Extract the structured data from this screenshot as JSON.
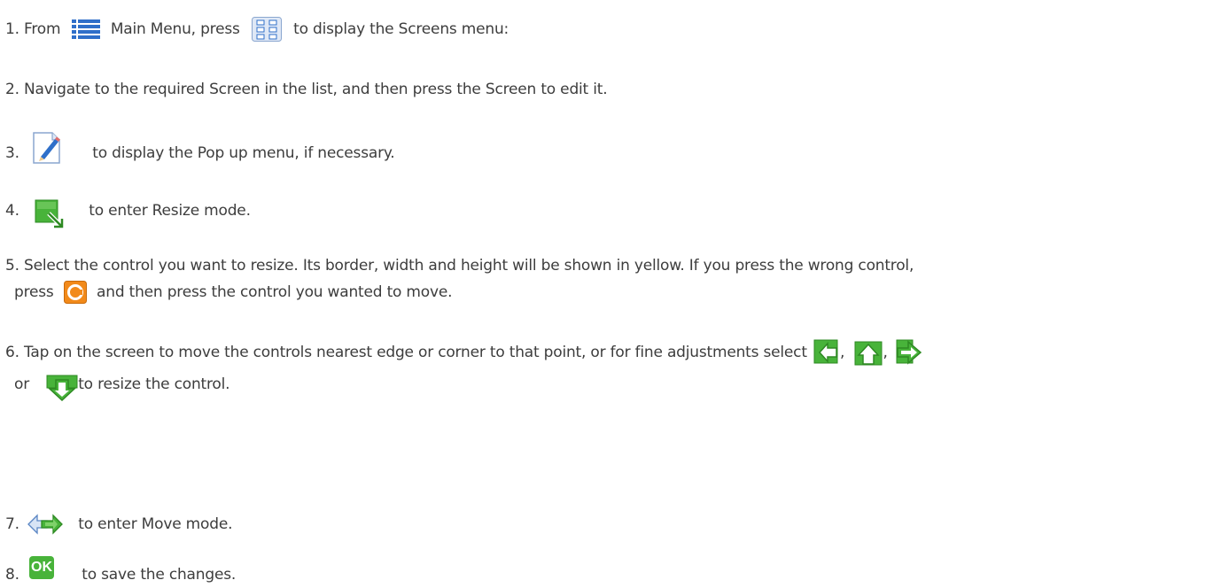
{
  "icons": {
    "main_menu": "main-menu-list-icon",
    "screens": "screens-grid-icon",
    "edit": "edit-pencil-icon",
    "resize": "resize-icon",
    "cancel": "cancel-c-icon",
    "left": "left-arrow-icon",
    "up": "up-arrow-icon",
    "right": "right-arrow-icon",
    "down": "down-arrow-icon",
    "move": "move-arrows-icon",
    "ok": "ok-icon"
  },
  "colors": {
    "text": "#3d3d3d",
    "icon_green": "#3fae2a",
    "icon_blue": "#2f6fc9",
    "icon_orange": "#f28a1a"
  },
  "steps": {
    "s1": {
      "num": "1.",
      "a": "From",
      "b": "Main Menu, press",
      "c": "to display the Screens menu:"
    },
    "s2": {
      "text": "2. Navigate to the required Screen in the list, and then press the Screen to edit it."
    },
    "s3": {
      "num": "3.",
      "text": "to display the Pop up menu, if necessary."
    },
    "s4": {
      "num": "4.",
      "text": "to enter Resize mode."
    },
    "s5": {
      "line1": "5. Select the control you want to resize. Its border, width and height will be shown in yellow. If you press the wrong control,",
      "a": "press",
      "b": "and then press the control you wanted to move."
    },
    "s6": {
      "line1": "6. Tap on the screen to move the controls nearest edge or corner to that point, or for fine adjustments select",
      "sep1": ",",
      "sep2": ",",
      "a": "or",
      "b": "to resize the control."
    },
    "s7": {
      "num": "7.",
      "text": "to enter Move mode."
    },
    "s8": {
      "num": "8.",
      "ok_label": "OK",
      "text": "to save the changes."
    }
  }
}
